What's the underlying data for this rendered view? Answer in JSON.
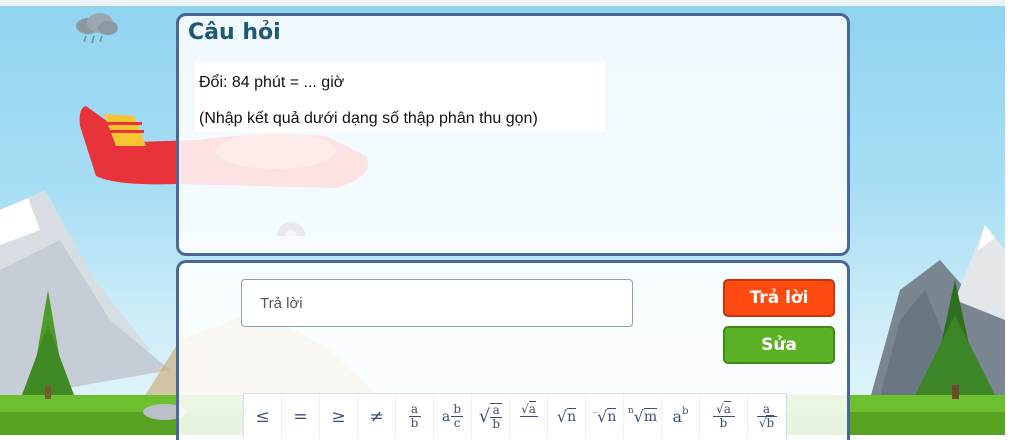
{
  "question": {
    "title": "Câu hỏi",
    "line1": "Đổi: 84 phút = ... giờ",
    "line2": "(Nhập kết quả dưới dạng số thập phân thu gọn)"
  },
  "answer": {
    "placeholder": "Trả lời",
    "submit_label": "Trả lời",
    "edit_label": "Sửa"
  },
  "toolbar": {
    "leq": "≤",
    "eq": "=",
    "geq": "≥",
    "neq": "≠",
    "frac_num": "a",
    "frac_den": "b",
    "mixed_whole": "a",
    "mixed_num": "b",
    "mixed_den": "c",
    "sqrt_frac_num": "a",
    "sqrt_frac_den": "b",
    "frac_sqrt_num": "a",
    "sqrt_n": "n",
    "cbrt_n": "n",
    "nth_root": "m",
    "nth_index": "n",
    "power_base": "a",
    "power_exp": "b",
    "frac_sqrt2_num": "a",
    "frac_sqrt2_den": "b",
    "frac_sqrt3_num": "a",
    "frac_sqrt3_den": "b"
  },
  "colors": {
    "panel_border": "#4a6796",
    "title": "#1e5a73",
    "submit": "#ff4a12",
    "edit": "#5bb224"
  }
}
